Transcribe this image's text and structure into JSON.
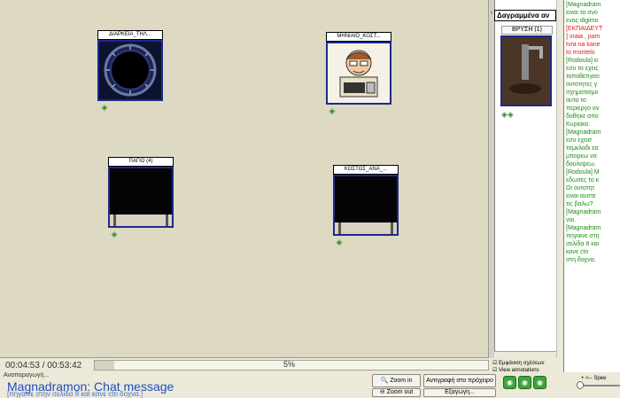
{
  "canvas": {
    "tiles": [
      {
        "title": "ΔΙΑΡΚΕΙΑ_ΤΗΛ...",
        "kind": "clock"
      },
      {
        "title": "ΜΗΝΙΑΙΟ_ΚΟΣΤ...",
        "kind": "person"
      },
      {
        "title": "ΠΑΓΙΟ (4)",
        "kind": "tv"
      },
      {
        "title": "ΚΟΣΤΟΣ_ΑΝΑ_...",
        "kind": "tv"
      }
    ]
  },
  "status": {
    "time": "00:04:53 / 00:53:42",
    "progress_percent": 5,
    "progress_text": "5%",
    "reproduce_label": "Αναπαραγωγή..."
  },
  "message": {
    "title": "Magnadramon: Chat message",
    "subtitle": "[πηγαινε στην σελίδα 8 και κανε ctn δοχνα.]"
  },
  "buttons": {
    "zoom_in": "Zoom in",
    "zoom_out": "Zoom out",
    "copy": "Αντιγραφή στο πρόχειρο",
    "export": "Εξαγωγη..."
  },
  "thumbs": {
    "header": "Δαγραμμένα αν",
    "item_label": "ΒΡΥΣΗ (1)"
  },
  "checkboxes": {
    "show_links": "Εμφάνιση σχέσεων",
    "view_annotations": "View annotations"
  },
  "chat": {
    "lines": [
      {
        "text": "[Magnadram",
        "color": "#1a8a12"
      },
      {
        "text": "ειναι το σνο",
        "color": "#1a8a12"
      },
      {
        "text": "ενος digimo",
        "color": "#1a8a12"
      },
      {
        "text": "[ΕΚΠΑΙΔΕΥΤ",
        "color": "#e01818"
      },
      {
        "text": "] vraia , pam",
        "color": "#e01818"
      },
      {
        "text": "tvra na kane",
        "color": "#e01818"
      },
      {
        "text": "to montelo",
        "color": "#e01818"
      },
      {
        "text": "[Rodoula] ει",
        "color": "#1a8a12"
      },
      {
        "text": "εσυ το εχεις",
        "color": "#1a8a12"
      },
      {
        "text": "τοποθετησει",
        "color": "#1a8a12"
      },
      {
        "text": "οντοτητες γ",
        "color": "#1a8a12"
      },
      {
        "text": "σχηματισμο",
        "color": "#1a8a12"
      },
      {
        "text": "αυτο το",
        "color": "#1a8a12"
      },
      {
        "text": "περιεργο ον",
        "color": "#1a8a12"
      },
      {
        "text": "δοθηκε απο",
        "color": "#1a8a12"
      },
      {
        "text": "Κυριακο.",
        "color": "#1a8a12"
      },
      {
        "text": "[Magnadram",
        "color": "#1a8a12"
      },
      {
        "text": "εσυ εχεισ",
        "color": "#1a8a12"
      },
      {
        "text": "τσμκλαδι εα",
        "color": "#1a8a12"
      },
      {
        "text": "μπορεω να",
        "color": "#1a8a12"
      },
      {
        "text": "δουλεψεω.",
        "color": "#1a8a12"
      },
      {
        "text": "[Rodoula] Μ",
        "color": "#1a8a12"
      },
      {
        "text": "εδωσες το κ",
        "color": "#1a8a12"
      },
      {
        "text": "Οι οντοτητ",
        "color": "#1a8a12"
      },
      {
        "text": "ειναι αυστε",
        "color": "#1a8a12"
      },
      {
        "text": "τις βαλω?",
        "color": "#1a8a12"
      },
      {
        "text": "[Magnadram",
        "color": "#1a8a12"
      },
      {
        "text": "ναι.",
        "color": "#1a8a12"
      },
      {
        "text": "[Magnadram",
        "color": "#1a8a12"
      },
      {
        "text": "πηγαινε στη",
        "color": "#1a8a12"
      },
      {
        "text": "σελίδα 8 και",
        "color": "#1a8a12"
      },
      {
        "text": "κανε ctn",
        "color": "#1a8a12"
      },
      {
        "text": "στη δοχνα.",
        "color": "#1a8a12"
      }
    ]
  },
  "speed": {
    "label": "+ <-- Spee"
  },
  "colors": {
    "accent": "#1a4ec9",
    "frame": "#1c2a8a",
    "canvas": "#ddd9c3"
  }
}
